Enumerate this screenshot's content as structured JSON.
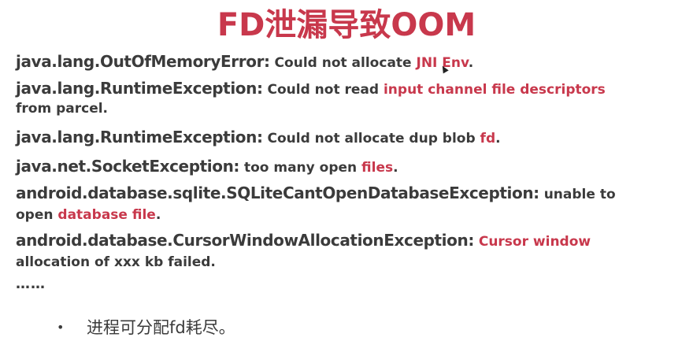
{
  "title": "FD泄漏导致OOM",
  "entries": [
    {
      "exception": "java.lang.OutOfMemoryError:",
      "msg_a": " Could not allocate ",
      "highlight": "JNI Env",
      "msg_b": "."
    },
    {
      "exception": "java.lang.RuntimeException:",
      "msg_a": " Could not read ",
      "highlight": "input channel file descriptors",
      "msg_b": "from parcel."
    },
    {
      "exception": "java.lang.RuntimeException:",
      "msg_a": " Could not allocate dup blob ",
      "highlight": "fd",
      "msg_b": "."
    },
    {
      "exception": "java.net.SocketException:",
      "msg_a": " too many open ",
      "highlight": "files",
      "msg_b": "."
    },
    {
      "exception": "android.database.sqlite.SQLiteCantOpenDatabaseException:",
      "msg_a": " unable to",
      "msg_c": "open ",
      "highlight": "database file",
      "msg_b": "."
    },
    {
      "exception": "android.database.CursorWindowAllocationException:",
      "msg_a": " ",
      "highlight": "Cursor window",
      "msg_b": "allocation of xxx kb failed."
    }
  ],
  "ellipsis": "……",
  "bullet": {
    "dot": "•",
    "text": "进程可分配fd耗尽。"
  },
  "colors": {
    "accent": "#c8384c",
    "text": "#3b3b3b"
  }
}
